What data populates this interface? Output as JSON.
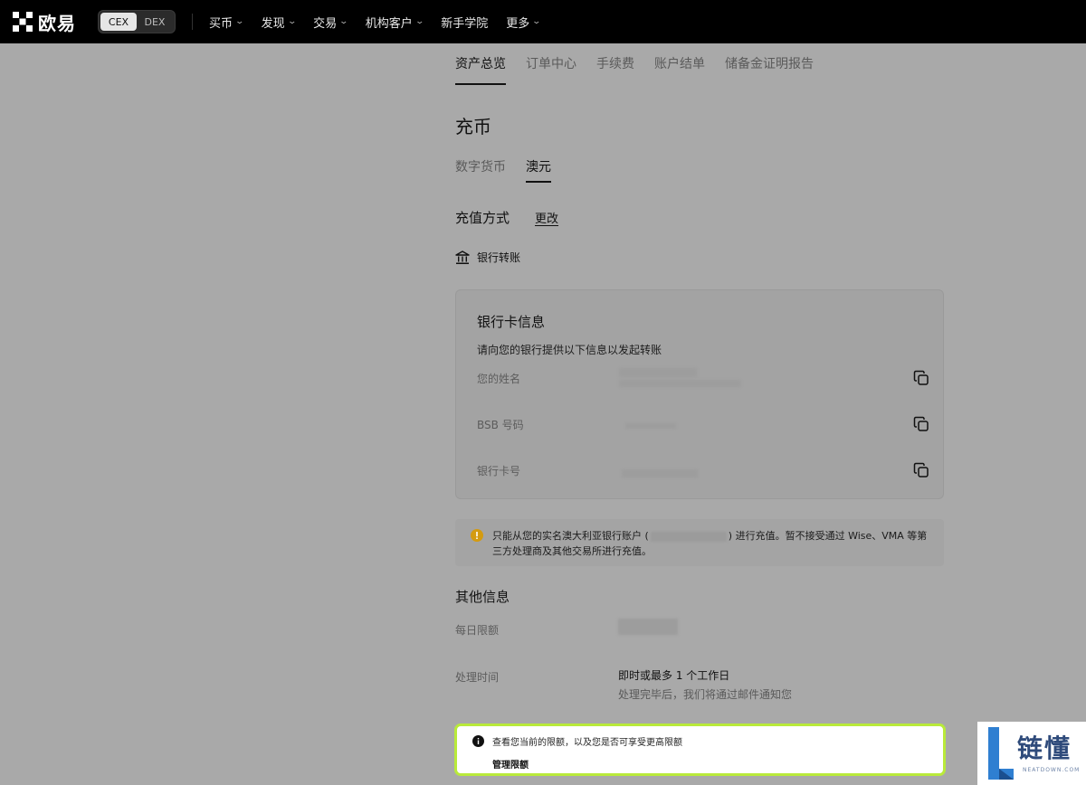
{
  "header": {
    "brand": "欧易",
    "mode_toggle": [
      "CEX",
      "DEX"
    ],
    "nav": [
      {
        "label": "买币",
        "dropdown": true
      },
      {
        "label": "发现",
        "dropdown": true
      },
      {
        "label": "交易",
        "dropdown": true
      },
      {
        "label": "机构客户",
        "dropdown": true
      },
      {
        "label": "新手学院",
        "dropdown": false
      },
      {
        "label": "更多",
        "dropdown": true
      }
    ]
  },
  "tabs": [
    "资产总览",
    "订单中心",
    "手续费",
    "账户结单",
    "储备金证明报告"
  ],
  "page_title": "充币",
  "subtabs": [
    "数字货币",
    "澳元"
  ],
  "method": {
    "label": "充值方式",
    "change": "更改",
    "selected": "银行转账"
  },
  "card": {
    "title": "银行卡信息",
    "desc": "请向您的银行提供以下信息以发起转账",
    "rows": [
      "您的姓名",
      "BSB 号码",
      "银行卡号"
    ]
  },
  "warning": {
    "text_before": "只能从您的实名澳大利亚银行账户 (",
    "text_after": ") 进行充值。暂不接受通过 Wise、VMA 等第三方处理商及其他交易所进行充值。"
  },
  "other": {
    "title": "其他信息",
    "daily_limit_label": "每日限额",
    "processing_label": "处理时间",
    "processing_value": "即时或最多 1 个工作日",
    "processing_note": "处理完毕后，我们将通过邮件通知您"
  },
  "limit_notice": {
    "text": "查看您当前的限额，以及您是否可享受更高限额",
    "link": "管理限额"
  },
  "watermark": {
    "name": "链懂",
    "sub": "NEATDOWN.COM"
  },
  "colors": {
    "topbar": "#000000",
    "overlay": "#a9a9a9",
    "highlight": "#b9ea3a",
    "warning_icon": "#d49b10"
  }
}
